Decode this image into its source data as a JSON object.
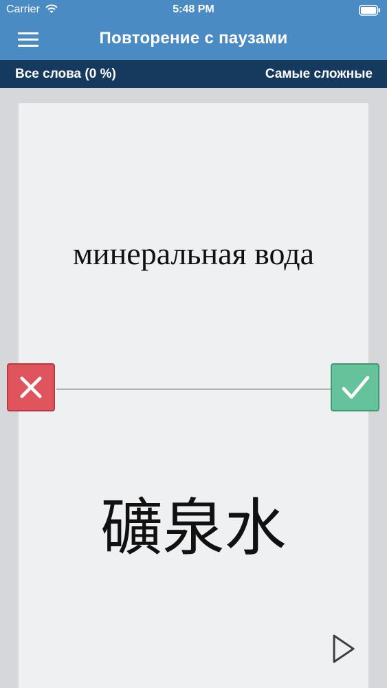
{
  "status_bar": {
    "carrier": "Carrier",
    "time": "5:48 PM",
    "icons": [
      "wifi-icon",
      "battery-icon"
    ]
  },
  "nav": {
    "title": "Повторение с паузами",
    "menu_icon": "menu-icon"
  },
  "filter_bar": {
    "left_label": "Все слова (0 %)",
    "right_label": "Самые сложные"
  },
  "card": {
    "front": "минеральная вода",
    "back": "礦泉水"
  },
  "actions": {
    "wrong_icon": "close-icon",
    "right_icon": "check-icon",
    "play_icon": "play-icon"
  },
  "colors": {
    "header": "#4a8bc4",
    "sub_bar": "#16395e",
    "card": "#eff0f2",
    "background": "#d5d7da",
    "wrong": "#e0545d",
    "right": "#66c29a"
  }
}
